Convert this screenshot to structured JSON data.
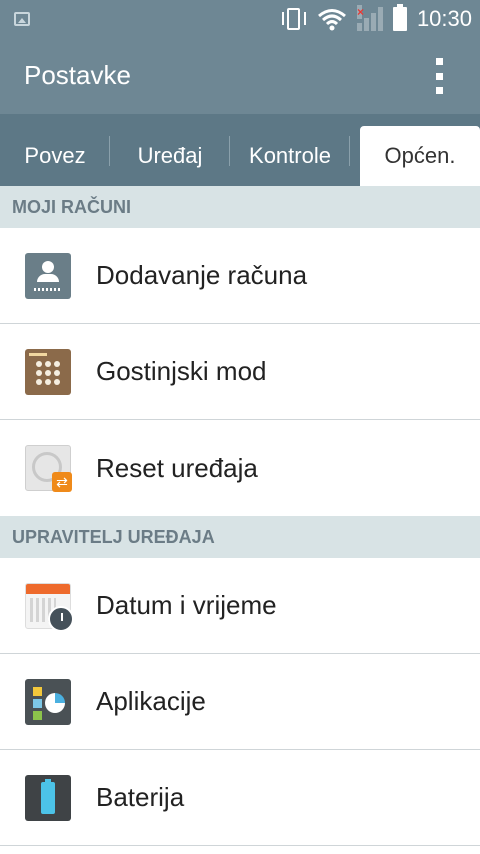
{
  "status_bar": {
    "time": "10:30"
  },
  "action_bar": {
    "title": "Postavke"
  },
  "tabs": [
    {
      "label": "Povez"
    },
    {
      "label": "Uređaj"
    },
    {
      "label": "Kontrole"
    },
    {
      "label": "Općen."
    }
  ],
  "sections": [
    {
      "header": "MOJI RAČUNI",
      "items": [
        {
          "label": "Dodavanje računa",
          "icon": "add-account-icon"
        },
        {
          "label": "Gostinjski mod",
          "icon": "guest-mode-icon"
        },
        {
          "label": "Reset uređaja",
          "icon": "reset-device-icon"
        }
      ]
    },
    {
      "header": "UPRAVITELJ UREĐAJA",
      "items": [
        {
          "label": "Datum i vrijeme",
          "icon": "date-time-icon"
        },
        {
          "label": "Aplikacije",
          "icon": "apps-icon"
        },
        {
          "label": "Baterija",
          "icon": "battery-settings-icon"
        }
      ]
    }
  ],
  "colors": {
    "header_bg": "#6e8794",
    "tab_bg": "#5d7886",
    "section_bg": "#d8e3e5"
  }
}
